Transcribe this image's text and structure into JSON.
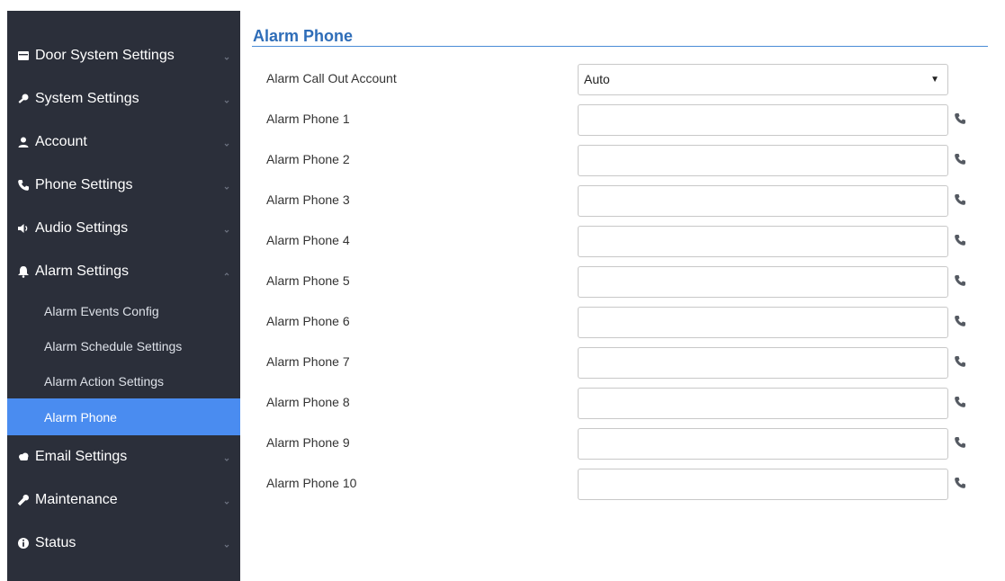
{
  "sidebar": {
    "menu": [
      {
        "label": "Door System Settings",
        "icon": "card-icon",
        "expanded": false
      },
      {
        "label": "System Settings",
        "icon": "key-icon",
        "expanded": false
      },
      {
        "label": "Account",
        "icon": "user-icon",
        "expanded": false
      },
      {
        "label": "Phone Settings",
        "icon": "phone-icon",
        "expanded": false
      },
      {
        "label": "Audio Settings",
        "icon": "speaker-icon",
        "expanded": false
      },
      {
        "label": "Alarm Settings",
        "icon": "bell-icon",
        "expanded": true
      },
      {
        "label": "Email Settings",
        "icon": "cloud-icon",
        "expanded": false
      },
      {
        "label": "Maintenance",
        "icon": "wrench-icon",
        "expanded": false
      },
      {
        "label": "Status",
        "icon": "info-icon",
        "expanded": false
      }
    ],
    "alarm_submenu": [
      {
        "label": "Alarm Events Config",
        "active": false
      },
      {
        "label": "Alarm Schedule Settings",
        "active": false
      },
      {
        "label": "Alarm Action Settings",
        "active": false
      },
      {
        "label": "Alarm Phone",
        "active": true
      }
    ],
    "active_color": "#4a8cf0",
    "background_color": "#2b2f3a"
  },
  "page": {
    "title": "Alarm Phone",
    "title_color": "#2e6db8"
  },
  "form": {
    "call_out": {
      "label": "Alarm Call Out Account",
      "selected": "Auto"
    },
    "phones": [
      {
        "label": "Alarm Phone 1",
        "value": ""
      },
      {
        "label": "Alarm Phone 2",
        "value": ""
      },
      {
        "label": "Alarm Phone 3",
        "value": ""
      },
      {
        "label": "Alarm Phone 4",
        "value": ""
      },
      {
        "label": "Alarm Phone 5",
        "value": ""
      },
      {
        "label": "Alarm Phone 6",
        "value": ""
      },
      {
        "label": "Alarm Phone 7",
        "value": ""
      },
      {
        "label": "Alarm Phone 8",
        "value": ""
      },
      {
        "label": "Alarm Phone 9",
        "value": ""
      },
      {
        "label": "Alarm Phone 10",
        "value": ""
      }
    ],
    "row_icon": "phone-icon"
  }
}
